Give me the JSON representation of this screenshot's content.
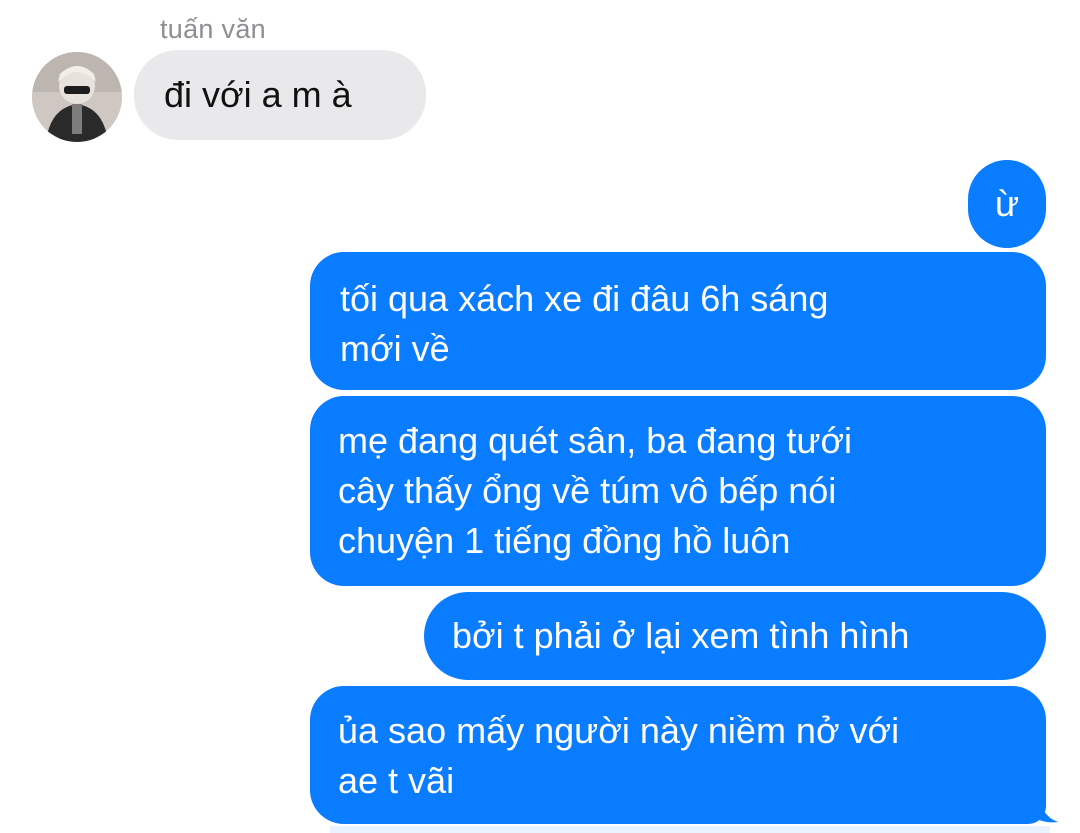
{
  "conversation": {
    "sender_name": "tuấn văn",
    "incoming": [
      {
        "text": "đi với a m à"
      }
    ],
    "outgoing": [
      {
        "lines": [
          "ừ"
        ]
      },
      {
        "lines": [
          "tối qua xách xe đi đâu 6h sáng",
          "mới về"
        ]
      },
      {
        "lines": [
          "mẹ đang quét sân, ba đang tưới",
          "cây thấy ổng về túm vô bếp nói",
          "chuyện 1 tiếng đồng hồ luôn"
        ]
      },
      {
        "lines": [
          "bởi t phải ở lại xem tình hình"
        ]
      },
      {
        "lines": [
          "ủa sao mấy người này niềm nở với",
          "ae t vãi"
        ]
      }
    ]
  },
  "colors": {
    "outgoing_bubble": "#0a7cff",
    "incoming_bubble": "#e9e9eb",
    "sender_name": "#8e8e93"
  },
  "icons": {
    "avatar": "profile-photo"
  }
}
